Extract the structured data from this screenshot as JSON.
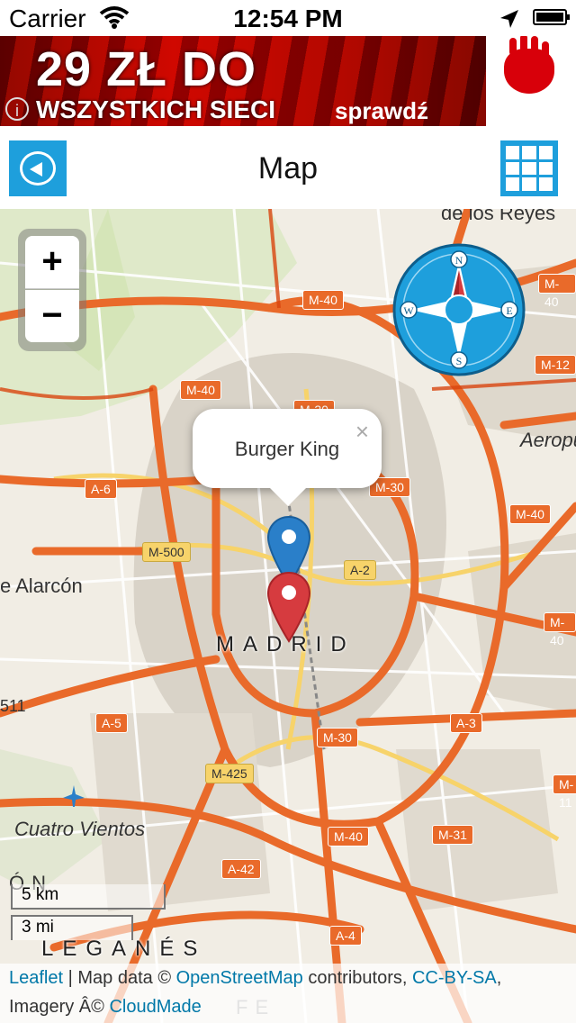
{
  "status_bar": {
    "carrier": "Carrier",
    "time": "12:54 PM"
  },
  "ad": {
    "headline": "29 ZŁ DO",
    "subline": "WSZYSTKICH SIECI",
    "cta": "sprawdź",
    "info_glyph": "i"
  },
  "navbar": {
    "title": "Map"
  },
  "map": {
    "zoom_in": "+",
    "zoom_out": "−",
    "compass": {
      "n": "N",
      "s": "S",
      "e": "E",
      "w": "W"
    },
    "popup": {
      "text": "Burger King",
      "close": "×"
    },
    "city": "MADRID",
    "places": {
      "top": "de los Reyes",
      "aeropuerto": "Aeropu",
      "alarcon": "e Alarcón",
      "cuatro_vientos": "Cuatro Vientos",
      "leganes": "LEGANÉS",
      "left_fragment": "ÓN",
      "num_511": "511",
      "bottom_fragment": "FE"
    },
    "roads": {
      "m40_a": "M-40",
      "m40_b": "M-40",
      "m40_c": "M-40",
      "m40_d": "M-40",
      "m40_e": "M-40",
      "m40_f": "M-40",
      "m30_a": "M-30",
      "m30_b": "M-30",
      "m30_c": "M-30",
      "m12": "M-12",
      "m11": "M-11",
      "m500": "M-500",
      "m425": "M-425",
      "a2": "A-2",
      "a3": "A-3",
      "a4": "A-4",
      "a5": "A-5",
      "a6": "A-6",
      "a42": "A-42",
      "m31": "M-31"
    },
    "scale": {
      "km": "5 km",
      "mi": "3 mi"
    },
    "attribution": {
      "leaflet": "Leaflet",
      "sep1": " | Map data © ",
      "osm": "OpenStreetMap",
      "contrib": " contributors, ",
      "ccbysa": "CC-BY-SA",
      "sep2": ",",
      "imagery": "Imagery Â© ",
      "cloudmade": "CloudMade"
    }
  },
  "colors": {
    "accent": "#1e9fdc",
    "road_major": "#e96a2a",
    "road_minor": "#f7d36a",
    "marker_blue": "#2a7fc9",
    "marker_red": "#d63b3f"
  }
}
